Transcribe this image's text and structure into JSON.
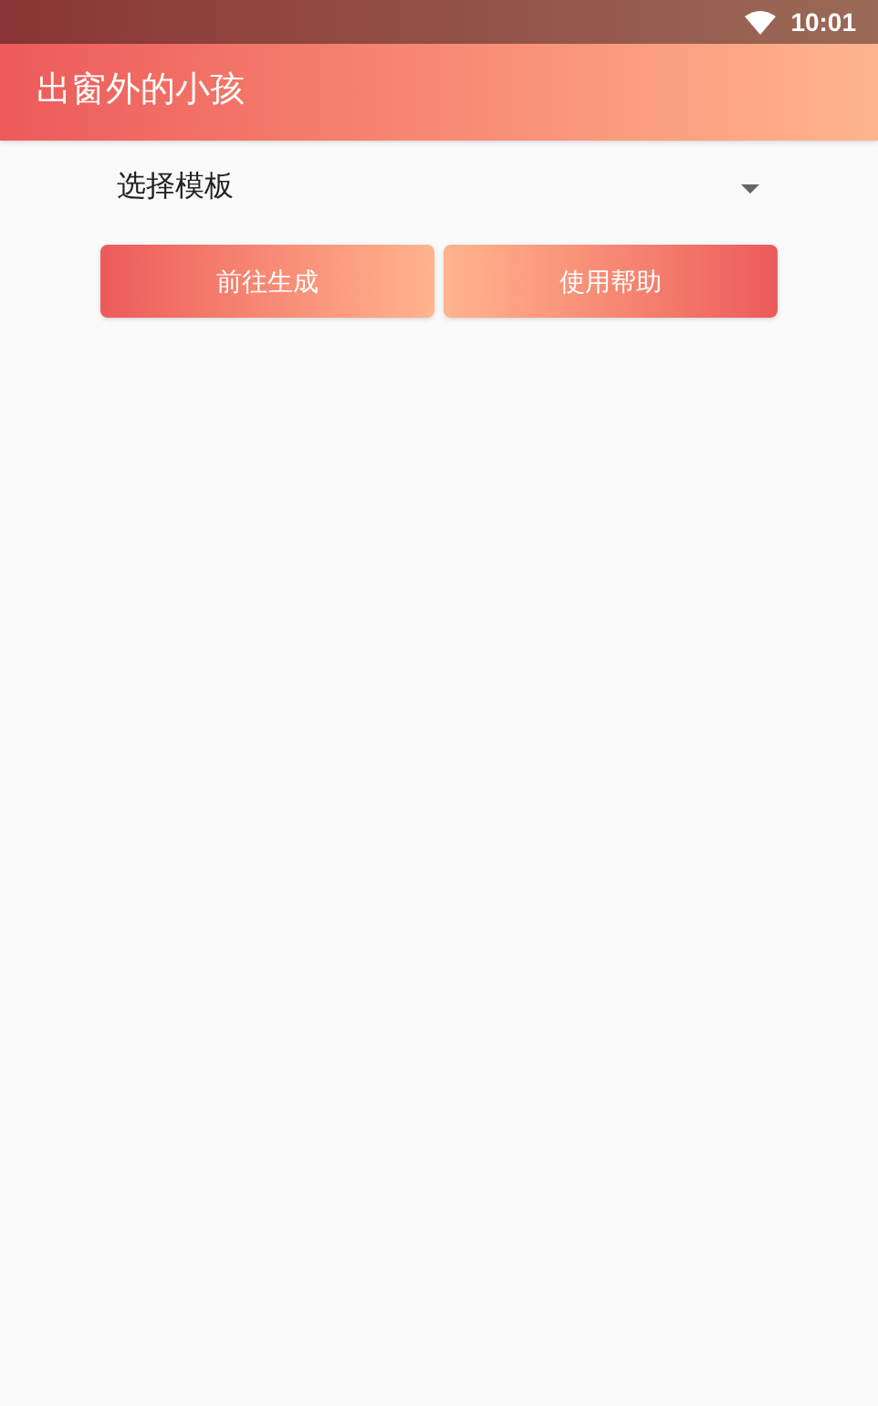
{
  "status_bar": {
    "time": "10:01"
  },
  "app_bar": {
    "title": "出窗外的小孩"
  },
  "template_select": {
    "value": "选择模板"
  },
  "buttons": [
    "前往生成",
    "使用帮助"
  ]
}
